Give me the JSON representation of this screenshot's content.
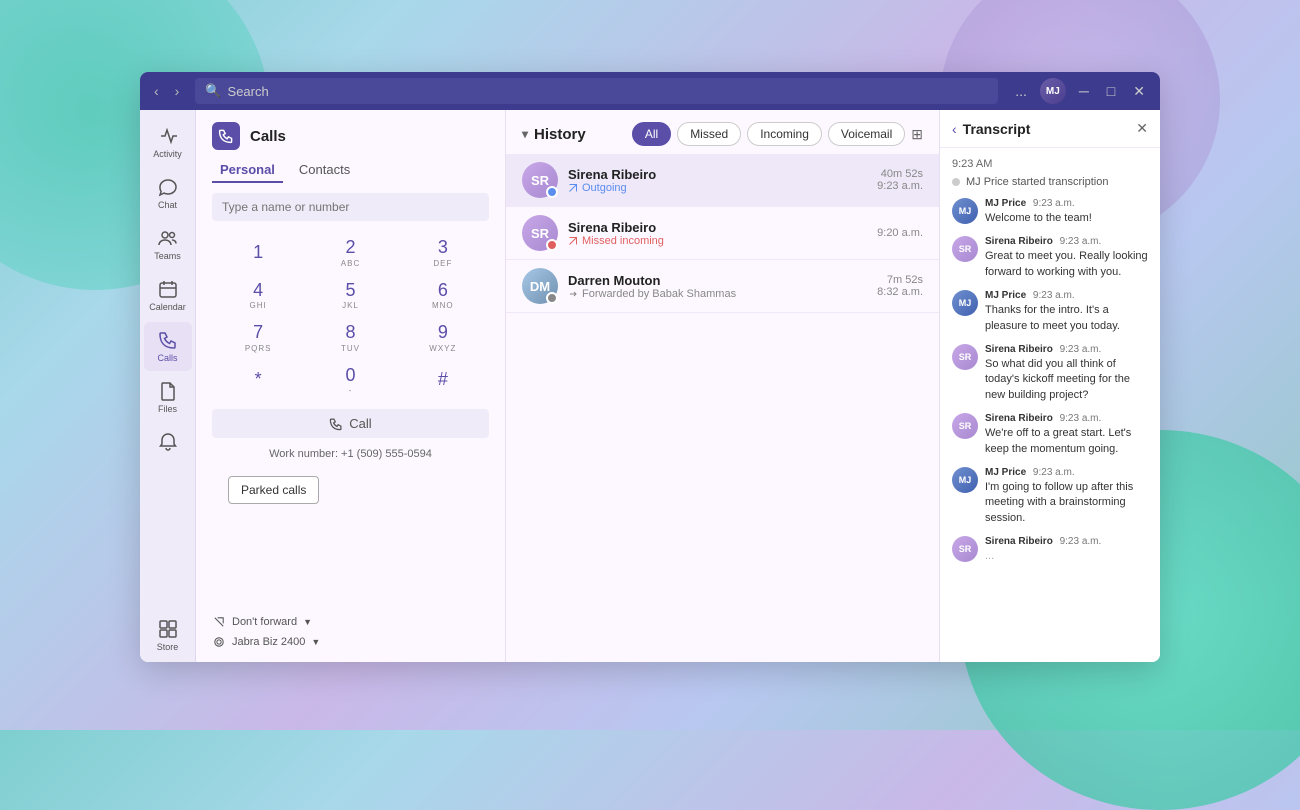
{
  "background": {
    "description": "Teams app window"
  },
  "titlebar": {
    "search_placeholder": "Search",
    "more_label": "...",
    "minimize": "─",
    "maximize": "□",
    "close": "✕"
  },
  "sidebar": {
    "items": [
      {
        "label": "Activity",
        "icon": "activity"
      },
      {
        "label": "Chat",
        "icon": "chat"
      },
      {
        "label": "Teams",
        "icon": "teams"
      },
      {
        "label": "Calendar",
        "icon": "calendar"
      },
      {
        "label": "Calls",
        "icon": "calls",
        "active": true
      },
      {
        "label": "Files",
        "icon": "files"
      },
      {
        "label": "",
        "icon": "notifications"
      },
      {
        "label": "Store",
        "icon": "store"
      }
    ]
  },
  "calls_panel": {
    "icon_label": "📞",
    "title": "Calls",
    "tabs": [
      {
        "label": "Personal",
        "active": true
      },
      {
        "label": "Contacts",
        "active": false
      }
    ],
    "input_placeholder": "Type a name or number",
    "dialpad": [
      {
        "num": "1",
        "letters": ""
      },
      {
        "num": "2",
        "letters": "ABC"
      },
      {
        "num": "3",
        "letters": "DEF"
      },
      {
        "num": "4",
        "letters": "GHI"
      },
      {
        "num": "5",
        "letters": "JKL"
      },
      {
        "num": "6",
        "letters": "MNO"
      },
      {
        "num": "7",
        "letters": "PQRS"
      },
      {
        "num": "8",
        "letters": "TUV"
      },
      {
        "num": "9",
        "letters": "WXYZ"
      },
      {
        "num": "*",
        "letters": ""
      },
      {
        "num": "0",
        "letters": "-"
      },
      {
        "num": "#",
        "letters": ""
      }
    ],
    "call_button": "Call",
    "work_number": "Work number: +1 (509) 555-0594",
    "parked_calls": "Parked calls",
    "dont_forward": "Don't forward",
    "device": "Jabra Biz 2400"
  },
  "history": {
    "title": "History",
    "filters": [
      "All",
      "Missed",
      "Incoming",
      "Voicemail"
    ],
    "active_filter": "All",
    "calls": [
      {
        "name": "Sirena Ribeiro",
        "sub": "Outgoing",
        "type": "outgoing",
        "duration": "40m 52s",
        "time": "9:23 a.m.",
        "avatar_initials": "SR",
        "status_color": "#5b8def"
      },
      {
        "name": "Sirena Ribeiro",
        "sub": "Missed incoming",
        "type": "missed",
        "duration": "",
        "time": "9:20 a.m.",
        "avatar_initials": "SR",
        "status_color": "#e06060"
      },
      {
        "name": "Darren Mouton",
        "sub": "Forwarded by Babak Shammas",
        "type": "forwarded",
        "duration": "7m 52s",
        "time": "8:32 a.m.",
        "avatar_initials": "DM",
        "status_color": "#888"
      }
    ]
  },
  "transcript": {
    "title": "Transcript",
    "time_header": "9:23 AM",
    "started_text": "MJ Price started transcription",
    "messages": [
      {
        "sender": "MJ Price",
        "sender_short": "MJ",
        "type": "mj",
        "time": "9:23 a.m.",
        "text": "Welcome to the team!"
      },
      {
        "sender": "Sirena Ribeiro",
        "sender_short": "SR",
        "type": "sr",
        "time": "9:23 a.m.",
        "text": "Great to meet you. Really looking forward to working with you."
      },
      {
        "sender": "MJ Price",
        "sender_short": "MJ",
        "type": "mj",
        "time": "9:23 a.m.",
        "text": "Thanks for the intro. It's a pleasure to meet you today."
      },
      {
        "sender": "Sirena Ribeiro",
        "sender_short": "SR",
        "type": "sr",
        "time": "9:23 a.m.",
        "text": "So what did you all think of today's kickoff meeting for the new building project?"
      },
      {
        "sender": "Sirena Ribeiro",
        "sender_short": "SR",
        "type": "sr",
        "time": "9:23 a.m.",
        "text": "We're off to a great start. Let's keep the momentum going."
      },
      {
        "sender": "MJ Price",
        "sender_short": "MJ",
        "type": "mj",
        "time": "9:23 a.m.",
        "text": "I'm going to follow up after this meeting with a brainstorming session."
      },
      {
        "sender": "Sirena Ribeiro",
        "sender_short": "SR",
        "type": "sr",
        "time": "9:23 a.m.",
        "text": "..."
      }
    ]
  }
}
